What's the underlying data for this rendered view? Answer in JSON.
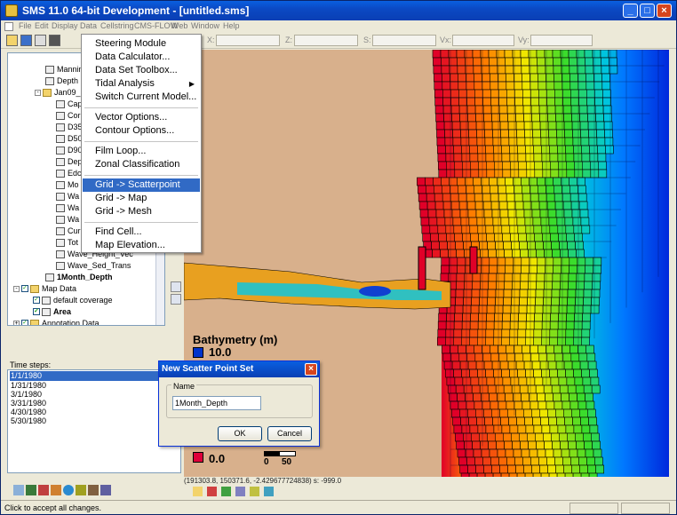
{
  "window": {
    "title": "SMS 11.0 64-bit Development - [untitled.sms]",
    "min_label": "_",
    "max_label": "□",
    "close_label": "×"
  },
  "menubar": [
    "File",
    "Edit",
    "Display",
    "Data",
    "Cellstring",
    "CMS-FLOW",
    "Web",
    "Window",
    "Help"
  ],
  "toolbar": {
    "x_label": "X:",
    "y_label": "Y:",
    "z_label": "Z:",
    "s_label": "S:",
    "vx_label": "Vx:",
    "vy_label": "Vy:"
  },
  "tree": {
    "rows": [
      {
        "label": "Manning",
        "bold": false
      },
      {
        "label": "Depth",
        "bold": false
      },
      {
        "label": "Jan09_",
        "bold": false
      },
      {
        "label": "Cap",
        "bold": false
      },
      {
        "label": "Cor",
        "bold": false
      },
      {
        "label": "D35",
        "bold": false
      },
      {
        "label": "D50",
        "bold": false
      },
      {
        "label": "D90",
        "bold": false
      },
      {
        "label": "Dep",
        "bold": false
      },
      {
        "label": "Edc",
        "bold": false
      },
      {
        "label": "Mo",
        "bold": false
      },
      {
        "label": "Wa",
        "bold": false
      },
      {
        "label": "Wa",
        "bold": false
      },
      {
        "label": "Wa",
        "bold": false
      },
      {
        "label": "Cur",
        "bold": false
      },
      {
        "label": "Tot",
        "bold": false
      },
      {
        "label": "Wave_Height_Vec",
        "bold": false
      },
      {
        "label": "Wave_Sed_Trans",
        "bold": false
      },
      {
        "label": "1Month_Depth",
        "bold": true
      },
      {
        "label": "Map Data",
        "bold": false
      },
      {
        "label": "default coverage",
        "bold": false
      },
      {
        "label": "Area",
        "bold": true
      },
      {
        "label": "Annotation Data",
        "bold": false
      }
    ]
  },
  "timesteps": {
    "label": "Time steps:",
    "items": [
      "1/1/1980",
      "1/31/1980",
      "3/1/1980",
      "3/31/1980",
      "4/30/1980",
      "5/30/1980"
    ],
    "selected_index": 0
  },
  "dropdown": {
    "items": [
      "Steering Module",
      "Data Calculator...",
      "Data Set Toolbox...",
      "Tidal Analysis",
      "Switch Current Model...",
      "Vector Options...",
      "Contour Options...",
      "Film Loop...",
      "Zonal Classification",
      "Grid -> Scatterpoint",
      "Grid -> Map",
      "Grid -> Mesh",
      "Find Cell...",
      "Map Elevation..."
    ],
    "highlighted": "Grid -> Scatterpoint",
    "submenu_arrow": "▶"
  },
  "legend": {
    "title": "Bathymetry (m)",
    "max_label": "10.0",
    "min_label": "0.0",
    "max_color": "#0033cc",
    "min_color": "#e0003a",
    "scale_0": "0",
    "scale_50": "50"
  },
  "dialog": {
    "title": "New Scatter Point Set",
    "close_label": "×",
    "group_label": "Name",
    "name_value": "1Month_Depth",
    "ok_label": "OK",
    "cancel_label": "Cancel"
  },
  "coord_readout": "(191303.8, 150371.6, -2.42967772483​8) s: -999.0",
  "status": {
    "message": "Click to accept all changes."
  },
  "colors": {
    "titlebar": "#0a49c4",
    "menu_highlight": "#316ac5",
    "land": "#d8b08c"
  }
}
